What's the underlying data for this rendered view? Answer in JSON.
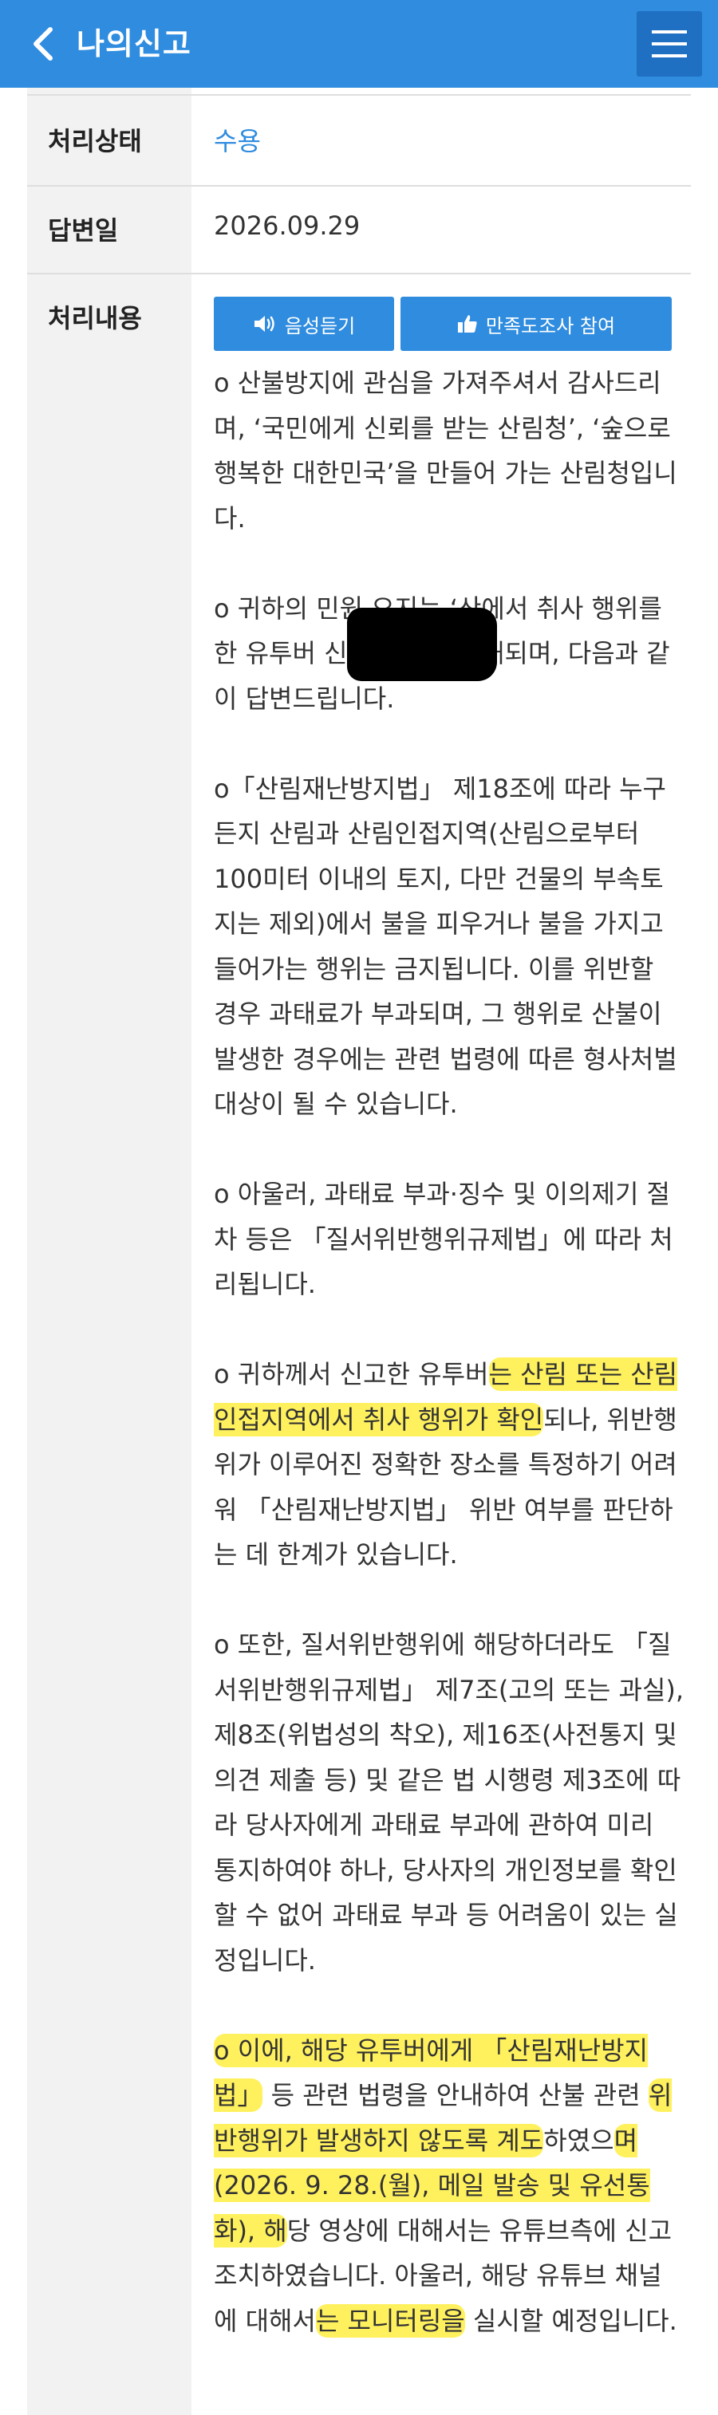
{
  "header": {
    "title": "나의신고"
  },
  "details": {
    "status_label": "처리상태",
    "status_value": "수용",
    "date_label": "답변일",
    "date_value": "2026.09.29",
    "content_label": "처리내용"
  },
  "actions": {
    "audio_label": "음성듣기",
    "survey_label": "만족도조사 참여"
  },
  "content": {
    "p1": "o 산불방지에 관심을 가져주셔서 감사드리며, ‘국민에게 신뢰를 받는 산림청’, ‘숲으로 행복한 대한민국’을 만들어 가는 산림청입니다.",
    "p2": "o 귀하의 민원 요지는 ‘산에서 취사 행위를 한 유투버 신고건’으로 이해되며, 다음과 같이 답변드립니다.",
    "p3": "o「산림재난방지법」 제18조에 따라 누구든지 산림과 산림인접지역(산림으로부터 100미터 이내의 토지, 다만 건물의 부속토지는 제외)에서 불을 피우거나 불을 가지고 들어가는 행위는 금지됩니다. 이를 위반할 경우 과태료가 부과되며, 그 행위로 산불이 발생한 경우에는 관련 법령에 따른 형사처벌 대상이 될 수 있습니다.",
    "p4": "o 아울러, 과태료 부과·징수 및 이의제기 절차 등은 「질서위반행위규제법」에 따라 처리됩니다.",
    "p5_a": "o 귀하께서 신고한 유투버",
    "p5_b": "는 산림 또는 산림인접지역에서 취사 행위가 확인",
    "p5_c": "되나, 위반행위가 이루어진 정확한 장소를 특정하기 어려워 「산림재난방지법」 위반 여부를 판단하는 데 한계가 있습니다.",
    "p6": "o 또한, 질서위반행위에 해당하더라도 「질서위반행위규제법」 제7조(고의 또는 과실), 제8조(위법성의 착오), 제16조(사전통지 및 의견 제출 등) 및 같은 법 시행령 제3조에 따라 당사자에게 과태료 부과에 관하여 미리 통지하여야 하나, 당사자의 개인정보를 확인할 수 없어 과태료 부과 등 어려움이 있는 실정입니다.",
    "p7_a": "o 이에, 해당 유투버에게 「산림재난방지법」",
    "p7_b": " 등 관련 법령을 안내하여 산불 관련 ",
    "p7_c": "위반행위가 발생하지 않도록 계도",
    "p7_d": "하였으",
    "p7_e": "며(2026. 9. 28.(월), 메일 발송 및 유선통화), 해",
    "p7_f": "당 영상에 대해서는 유튜브측에 신고 조치하였습니다. 아울러, 해당 유튜브 채널에 대해서",
    "p7_g": "는 모니터링을",
    "p7_h": " 실시할 예정입니다."
  },
  "icons": {
    "back": "chevron-left-icon",
    "menu": "hamburger-menu-icon",
    "audio": "speaker-icon",
    "survey": "thumbs-up-icon"
  },
  "colors": {
    "brand": "#2f8cdf",
    "highlight": "#ffec28",
    "status": "#2f8cdf"
  }
}
